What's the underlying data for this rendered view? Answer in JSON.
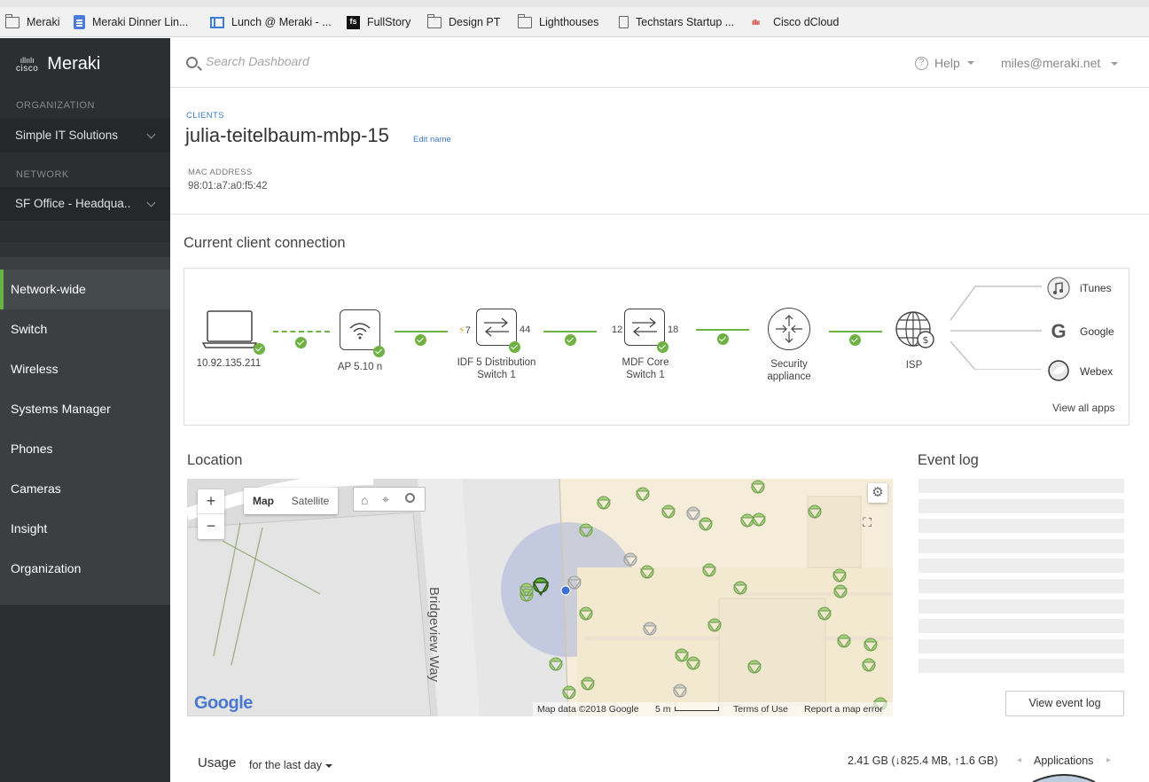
{
  "bookmarks": [
    {
      "label": "Meraki",
      "icon": "folder-icon"
    },
    {
      "label": "Meraki Dinner Lin...",
      "icon": "doc-icon"
    },
    {
      "label": "Lunch @ Meraki - ...",
      "icon": "calendar-icon"
    },
    {
      "label": "FullStory",
      "icon": "fullstory-icon"
    },
    {
      "label": "Design PT",
      "icon": "folder-icon"
    },
    {
      "label": "Lighthouses",
      "icon": "folder-icon"
    },
    {
      "label": "Techstars Startup ...",
      "icon": "page-icon"
    },
    {
      "label": "Cisco dCloud",
      "icon": "cisco-icon"
    }
  ],
  "sidebar": {
    "brand": "Meraki",
    "cisco_logo": "cisco",
    "org_label": "ORGANIZATION",
    "org_value": "Simple IT Solutions",
    "network_label": "NETWORK",
    "network_value": "SF Office - Headqua..",
    "items": [
      {
        "label": "Network-wide",
        "active": true
      },
      {
        "label": "Switch"
      },
      {
        "label": "Wireless"
      },
      {
        "label": "Systems Manager"
      },
      {
        "label": "Phones"
      },
      {
        "label": "Cameras"
      },
      {
        "label": "Insight"
      },
      {
        "label": "Organization"
      }
    ]
  },
  "header": {
    "search_placeholder": "Search Dashboard",
    "help": "Help",
    "user": "miles@meraki.net"
  },
  "client": {
    "breadcrumb": "CLIENTS",
    "name": "julia-teitelbaum-mbp-15",
    "edit": "Edit name",
    "mac_label": "MAC ADDRESS",
    "mac_value": "98:01:a7:a0:f5:42"
  },
  "connection": {
    "title": "Current client connection",
    "client_ip": "10.92.135.211",
    "ap": "AP 5.10 n",
    "switch1": {
      "name": "IDF 5 Distribution Switch 1",
      "line1": "IDF 5 Distribution",
      "line2": "Switch 1",
      "port_in": "7",
      "port_out": "44"
    },
    "switch2": {
      "name": "MDF Core Switch 1",
      "line1": "MDF Core",
      "line2": "Switch 1",
      "port_in": "12",
      "port_out": "18"
    },
    "security": {
      "line1": "Security",
      "line2": "appliance"
    },
    "isp": "ISP",
    "apps": [
      "iTunes",
      "Google",
      "Webex"
    ],
    "view_all": "View all apps",
    "accent": "#6fb143"
  },
  "location": {
    "title": "Location",
    "map_btn": "Map",
    "satellite_btn": "Satellite",
    "street": "Bridgeview Way",
    "google": "Google",
    "map_data": "Map data ©2018 Google",
    "scale": "5 m",
    "terms": "Terms of Use",
    "report": "Report a map error",
    "zoom_in": "+",
    "zoom_out": "−"
  },
  "event_log": {
    "title": "Event log",
    "button": "View event log"
  },
  "usage": {
    "title": "Usage",
    "range": "for the last day",
    "total": "2.41 GB (↓825.4 MB, ↑1.6 GB)",
    "tab": "Applications"
  }
}
